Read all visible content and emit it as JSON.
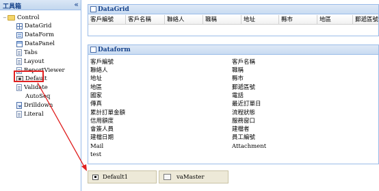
{
  "toolbox": {
    "title": "工具箱",
    "collapse_glyph": "«",
    "items": [
      {
        "label": "Control",
        "icon": "folder-icon",
        "twisty": "−"
      },
      {
        "label": "DataGrid",
        "icon": "datagrid-icon"
      },
      {
        "label": "DataForm",
        "icon": "dataform-icon"
      },
      {
        "label": "DataPanel",
        "icon": "datapanel-icon"
      },
      {
        "label": "Tabs",
        "icon": "document-icon"
      },
      {
        "label": "Layout",
        "icon": "document-icon"
      },
      {
        "label": "ReportViewer",
        "icon": "document-icon"
      },
      {
        "label": "Default",
        "icon": "button-icon",
        "selected": true
      },
      {
        "label": "Validate",
        "icon": "document-icon"
      },
      {
        "label": "AutoSeq",
        "icon": ""
      },
      {
        "label": "Drilldown",
        "icon": "dropdown-icon"
      },
      {
        "label": "Literal",
        "icon": "document-icon"
      }
    ]
  },
  "datagrid": {
    "title": "DataGrid",
    "columns": [
      "客戶編號",
      "客戶名稱",
      "聯絡人",
      "職稱",
      "地址",
      "縣市",
      "地區",
      "郵遞區號"
    ]
  },
  "dataform": {
    "title": "Dataform",
    "left_fields": [
      "客戶編號",
      "聯絡人",
      "地址",
      "地區",
      "國家",
      "傳真",
      "累計訂單金額",
      "信用額度",
      "會簽人員",
      "建檔日期",
      "Mail",
      "test"
    ],
    "right_fields": [
      "客戶名稱",
      "職稱",
      "縣市",
      "郵遞區號",
      "電話",
      "最近訂單日",
      "流程狀態",
      "服務窗口",
      "建檔者",
      "員工編號",
      "Attachment"
    ]
  },
  "components": [
    {
      "label": "Default1",
      "icon": "button-icon"
    },
    {
      "label": "vaMaster",
      "icon": "validate-icon"
    }
  ],
  "colors": {
    "accent": "#15428b",
    "border": "#99bbe8",
    "arrow": "#e02020",
    "component_bg": "#ede9d8"
  }
}
